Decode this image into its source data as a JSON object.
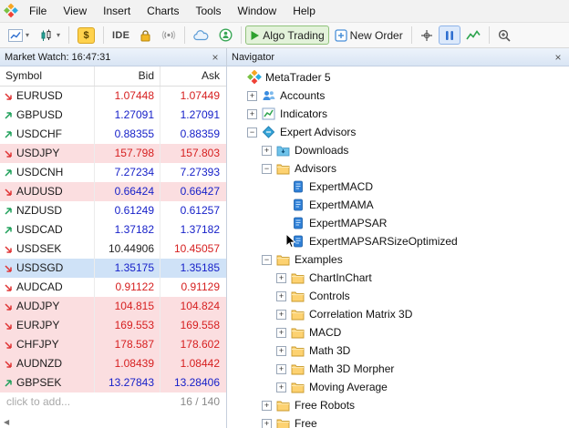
{
  "window": {
    "app": "MetaTrader 5"
  },
  "ui": {
    "close": "×",
    "caret": "▾"
  },
  "menu": {
    "items": [
      "File",
      "View",
      "Insert",
      "Charts",
      "Tools",
      "Window",
      "Help"
    ]
  },
  "toolbar": {
    "dollar": "$",
    "ide": "IDE",
    "algo_trading": "Algo Trading",
    "new_order": "New Order"
  },
  "market_watch": {
    "title": "Market Watch: 16:47:31",
    "columns": {
      "symbol": "Symbol",
      "bid": "Bid",
      "ask": "Ask"
    },
    "rows": [
      {
        "symbol": "EURUSD",
        "bid": "1.07448",
        "ask": "1.07449",
        "dir": "down",
        "bid_color": "red",
        "ask_color": "red",
        "bg": "white"
      },
      {
        "symbol": "GBPUSD",
        "bid": "1.27091",
        "ask": "1.27091",
        "dir": "up",
        "bid_color": "blue",
        "ask_color": "blue",
        "bg": "white"
      },
      {
        "symbol": "USDCHF",
        "bid": "0.88355",
        "ask": "0.88359",
        "dir": "up",
        "bid_color": "blue",
        "ask_color": "blue",
        "bg": "white"
      },
      {
        "symbol": "USDJPY",
        "bid": "157.798",
        "ask": "157.803",
        "dir": "down",
        "bid_color": "red",
        "ask_color": "red",
        "bg": "pink"
      },
      {
        "symbol": "USDCNH",
        "bid": "7.27234",
        "ask": "7.27393",
        "dir": "up",
        "bid_color": "blue",
        "ask_color": "blue",
        "bg": "white"
      },
      {
        "symbol": "AUDUSD",
        "bid": "0.66424",
        "ask": "0.66427",
        "dir": "down",
        "bid_color": "blue",
        "ask_color": "blue",
        "bg": "pink"
      },
      {
        "symbol": "NZDUSD",
        "bid": "0.61249",
        "ask": "0.61257",
        "dir": "up",
        "bid_color": "blue",
        "ask_color": "blue",
        "bg": "white"
      },
      {
        "symbol": "USDCAD",
        "bid": "1.37182",
        "ask": "1.37182",
        "dir": "up",
        "bid_color": "blue",
        "ask_color": "blue",
        "bg": "white"
      },
      {
        "symbol": "USDSEK",
        "bid": "10.44906",
        "ask": "10.45057",
        "dir": "down",
        "bid_color": "black",
        "ask_color": "red",
        "bg": "white"
      },
      {
        "symbol": "USDSGD",
        "bid": "1.35175",
        "ask": "1.35185",
        "dir": "down",
        "bid_color": "blue",
        "ask_color": "blue",
        "bg": "selected"
      },
      {
        "symbol": "AUDCAD",
        "bid": "0.91122",
        "ask": "0.91129",
        "dir": "down",
        "bid_color": "red",
        "ask_color": "red",
        "bg": "white"
      },
      {
        "symbol": "AUDJPY",
        "bid": "104.815",
        "ask": "104.824",
        "dir": "down",
        "bid_color": "red",
        "ask_color": "red",
        "bg": "pink"
      },
      {
        "symbol": "EURJPY",
        "bid": "169.553",
        "ask": "169.558",
        "dir": "down",
        "bid_color": "red",
        "ask_color": "red",
        "bg": "pink"
      },
      {
        "symbol": "CHFJPY",
        "bid": "178.587",
        "ask": "178.602",
        "dir": "down",
        "bid_color": "red",
        "ask_color": "red",
        "bg": "pink"
      },
      {
        "symbol": "AUDNZD",
        "bid": "1.08439",
        "ask": "1.08442",
        "dir": "down",
        "bid_color": "red",
        "ask_color": "red",
        "bg": "pink"
      },
      {
        "symbol": "GBPSEK",
        "bid": "13.27843",
        "ask": "13.28406",
        "dir": "up",
        "bid_color": "blue",
        "ask_color": "blue",
        "bg": "pink"
      }
    ],
    "footer": {
      "left": "click to add...",
      "right": "16 / 140"
    },
    "scroll_left": "◀"
  },
  "navigator": {
    "title": "Navigator",
    "tree": [
      {
        "label": "MetaTrader 5",
        "level": 0,
        "icon": "mt5",
        "expander": "none"
      },
      {
        "label": "Accounts",
        "level": 1,
        "icon": "accounts",
        "expander": "plus"
      },
      {
        "label": "Indicators",
        "level": 1,
        "icon": "indicators",
        "expander": "plus"
      },
      {
        "label": "Expert Advisors",
        "level": 1,
        "icon": "experts",
        "expander": "minus"
      },
      {
        "label": "Downloads",
        "level": 2,
        "icon": "downloads",
        "expander": "plus"
      },
      {
        "label": "Advisors",
        "level": 2,
        "icon": "folder",
        "expander": "minus"
      },
      {
        "label": "ExpertMACD",
        "level": 3,
        "icon": "ea",
        "expander": "none"
      },
      {
        "label": "ExpertMAMA",
        "level": 3,
        "icon": "ea",
        "expander": "none"
      },
      {
        "label": "ExpertMAPSAR",
        "level": 3,
        "icon": "ea",
        "expander": "none"
      },
      {
        "label": "ExpertMAPSARSizeOptimized",
        "level": 3,
        "icon": "ea",
        "expander": "none",
        "cursor": true
      },
      {
        "label": "Examples",
        "level": 2,
        "icon": "folder",
        "expander": "minus"
      },
      {
        "label": "ChartInChart",
        "level": 3,
        "icon": "folder",
        "expander": "plus"
      },
      {
        "label": "Controls",
        "level": 3,
        "icon": "folder",
        "expander": "plus"
      },
      {
        "label": "Correlation Matrix 3D",
        "level": 3,
        "icon": "folder",
        "expander": "plus"
      },
      {
        "label": "MACD",
        "level": 3,
        "icon": "folder",
        "expander": "plus"
      },
      {
        "label": "Math 3D",
        "level": 3,
        "icon": "folder",
        "expander": "plus"
      },
      {
        "label": "Math 3D Morpher",
        "level": 3,
        "icon": "folder",
        "expander": "plus"
      },
      {
        "label": "Moving Average",
        "level": 3,
        "icon": "folder",
        "expander": "plus"
      },
      {
        "label": "Free Robots",
        "level": 2,
        "icon": "folder",
        "expander": "plus"
      },
      {
        "label": "Free",
        "level": 2,
        "icon": "folder",
        "expander": "plus"
      }
    ]
  },
  "colors": {
    "tick_up": "#1fa05a",
    "tick_down": "#e03434",
    "price_blue": "#1721c9",
    "price_red": "#d61f1f",
    "row_flash_pink": "#fbdee0",
    "row_selected_blue": "#cfe2f7",
    "algo_trading_green": "#2ea12e"
  }
}
